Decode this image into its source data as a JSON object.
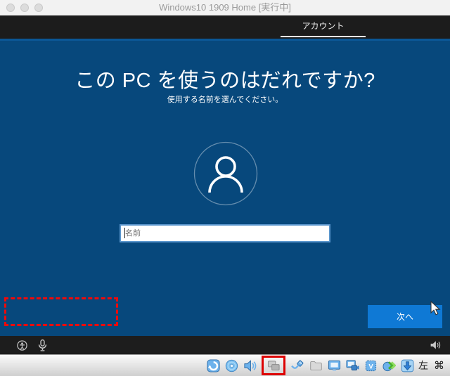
{
  "window": {
    "title": "Windows10 1909 Home [実行中]",
    "traffic_lights": [
      "close-button",
      "minimize-button",
      "zoom-button"
    ],
    "state": "inactive"
  },
  "oobe": {
    "header": {
      "tab_label": "アカウント",
      "background": "#1c1c1c",
      "underline_color": "#ffffff"
    },
    "content": {
      "heading": "この PC を使うのはだれですか?",
      "subheading": "使用する名前を選んでください。",
      "avatar_icon": "user-icon",
      "name_input": {
        "placeholder": "名前",
        "value": ""
      },
      "next_button_label": "次へ",
      "background": "#07487c",
      "next_button_color": "#0f79d5"
    },
    "footer": {
      "icons": [
        "ease-of-access-icon",
        "microphone-icon",
        "volume-icon"
      ],
      "background": "#1d1d1d"
    }
  },
  "annotations": {
    "dashed_box": {
      "style": "red-dashed-rectangle",
      "color": "#ee0a0a",
      "location": "bottom-left-of-screen"
    },
    "statusbar_highlight": {
      "style": "red-solid-rectangle",
      "color": "#dd0000",
      "target": "network-icon"
    }
  },
  "statusbar": {
    "icons": [
      "hard-disk-icon",
      "optical-disk-icon",
      "audio-icon",
      "network-icon",
      "usb-icon",
      "shared-folders-icon",
      "display-icon",
      "recording-icon",
      "features-icon",
      "mouse-integration-icon",
      "keyboard-icon"
    ],
    "host_key_label": "左",
    "command_symbol": "⌘"
  },
  "cursor": {
    "icon": "mouse-pointer-icon",
    "position": "over-next-button"
  }
}
